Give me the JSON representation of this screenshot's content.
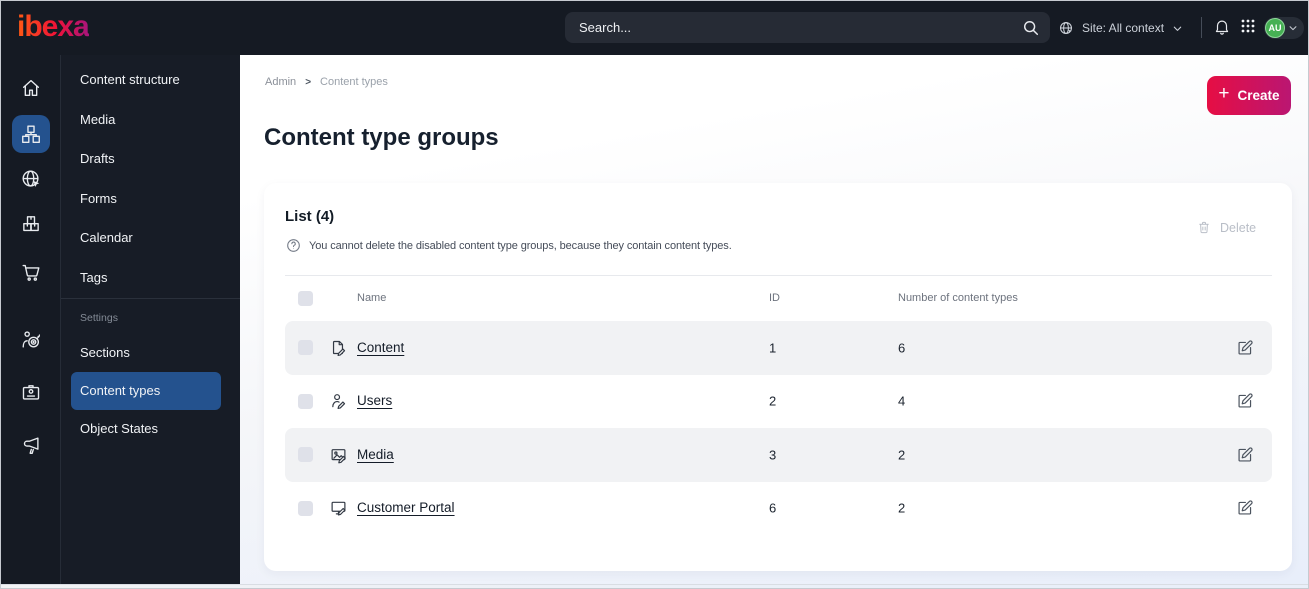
{
  "topbar": {
    "logo_text": "ibexa",
    "search_placeholder": "Search...",
    "site_context_label": "Site: All context",
    "avatar_initials": "AU"
  },
  "sidebar": {
    "rail_items": [
      {
        "icon": "home-icon"
      },
      {
        "icon": "content-structure-icon",
        "selected": true
      },
      {
        "icon": "site-globe-icon"
      },
      {
        "icon": "product-catalog-icon"
      },
      {
        "icon": "commerce-cart-icon"
      },
      {
        "icon": "personalization-target-icon"
      },
      {
        "icon": "admin-badge-icon"
      },
      {
        "icon": "marketing-megaphone-icon"
      }
    ],
    "menu_items": [
      {
        "label": "Content structure"
      },
      {
        "label": "Media"
      },
      {
        "label": "Drafts"
      },
      {
        "label": "Forms"
      },
      {
        "label": "Calendar"
      },
      {
        "label": "Tags"
      }
    ],
    "settings_label": "Settings",
    "settings_items": [
      {
        "label": "Sections"
      },
      {
        "label": "Content types",
        "selected": true
      },
      {
        "label": "Object States"
      }
    ]
  },
  "breadcrumb": {
    "root": "Admin",
    "current": "Content types"
  },
  "page": {
    "title": "Content type groups",
    "create_label": "Create"
  },
  "card": {
    "list_title": "List (4)",
    "info_text": "You cannot delete the disabled content type groups, because they contain content types.",
    "delete_label": "Delete",
    "table": {
      "columns": {
        "name": "Name",
        "id": "ID",
        "count": "Number of content types"
      },
      "rows": [
        {
          "icon": "content-file-icon",
          "name": "Content",
          "id": "1",
          "count": "6"
        },
        {
          "icon": "users-person-icon",
          "name": "Users",
          "id": "2",
          "count": "4"
        },
        {
          "icon": "media-image-icon",
          "name": "Media",
          "id": "3",
          "count": "2"
        },
        {
          "icon": "customer-portal-icon",
          "name": "Customer Portal",
          "id": "6",
          "count": "2"
        }
      ]
    }
  },
  "colors": {
    "topbar_bg": "#151a23",
    "sidebar_bg": "#171c26",
    "selected_blue": "#24528e",
    "create_gradient_start": "#e60e44",
    "create_gradient_end": "#ba1672",
    "avatar_green": "#46b054",
    "row_stripe": "#f1f2f4",
    "text_dark": "#131c26"
  }
}
